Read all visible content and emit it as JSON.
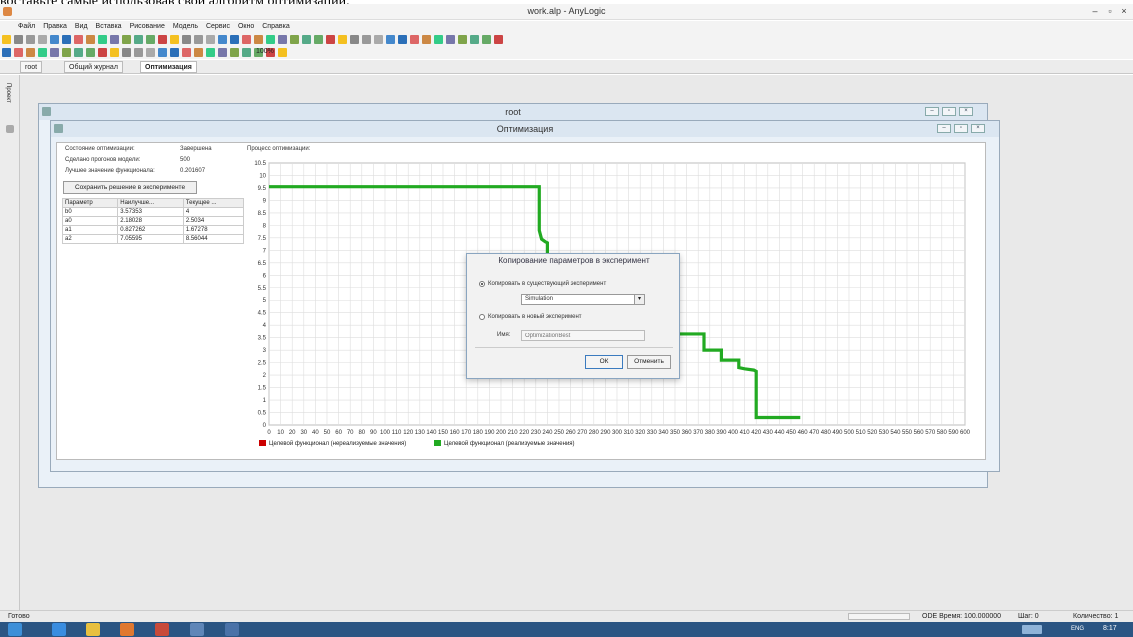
{
  "stripe_text": "воставьте самые использовав свой алгоритм оптимизации.",
  "window": {
    "title": "work.alp - AnyLogic",
    "min": "–",
    "max": "▫",
    "close": "×"
  },
  "menu": [
    "Файл",
    "Правка",
    "Вид",
    "Вставка",
    "Рисование",
    "Модель",
    "Сервис",
    "Окно",
    "Справка"
  ],
  "toolbar": {
    "zoom": "100%"
  },
  "tabs": [
    "root",
    "Общий журнал",
    "Оптимизация"
  ],
  "side_tab": "Проект",
  "mdi_root": {
    "title": "root"
  },
  "mdi_opt": {
    "title": "Оптимизация"
  },
  "opt": {
    "state_label": "Состояние оптимизации:",
    "state_value": "Завершена",
    "runs_label": "Сделано прогонов модели:",
    "runs_value": "500",
    "best_label": "Лучшее значение функционала:",
    "best_value": "0.201607",
    "save_button": "Сохранить решение в эксперименте",
    "progress_label": "Процесс оптимизации:",
    "table": {
      "headers": [
        "Параметр",
        "Наилучше...",
        "Текущее ..."
      ],
      "rows": [
        [
          "b0",
          "3.57353",
          "4"
        ],
        [
          "a0",
          "2.18028",
          "2.5034"
        ],
        [
          "a1",
          "0.827262",
          "1.67278"
        ],
        [
          "a2",
          "7.05595",
          "8.56044"
        ]
      ]
    }
  },
  "chart_data": {
    "type": "line",
    "xlim": [
      0,
      600
    ],
    "ylim": [
      0,
      10.5
    ],
    "grid": true,
    "legend_position": "bottom-left",
    "x_ticks": [
      0,
      10,
      20,
      30,
      40,
      50,
      60,
      70,
      80,
      90,
      100,
      110,
      120,
      130,
      140,
      150,
      160,
      170,
      180,
      190,
      200,
      210,
      220,
      230,
      240,
      250,
      260,
      270,
      280,
      290,
      300,
      310,
      320,
      330,
      340,
      350,
      360,
      370,
      380,
      390,
      400,
      410,
      420,
      430,
      440,
      450,
      460,
      470,
      480,
      490,
      500,
      510,
      520,
      530,
      540,
      550,
      560,
      570,
      580,
      590,
      600
    ],
    "y_ticks": [
      0,
      0.5,
      1,
      1.5,
      2,
      2.5,
      3,
      3.5,
      4,
      4.5,
      5,
      5.5,
      6,
      6.5,
      7,
      7.5,
      8,
      8.5,
      9,
      9.5,
      10,
      10.5
    ],
    "series": [
      {
        "name": "Целевой функционал (нереализуемые значения)",
        "color": "#cc0000",
        "points": []
      },
      {
        "name": "Целевой функционал (реализуемые значения)",
        "color": "#22aa22",
        "points": [
          [
            0,
            9.55
          ],
          [
            233,
            9.55
          ],
          [
            233,
            7.8
          ],
          [
            235,
            7.45
          ],
          [
            238,
            7.35
          ],
          [
            240,
            7.3
          ],
          [
            240,
            4.1
          ],
          [
            350,
            4.1
          ],
          [
            350,
            3.65
          ],
          [
            375,
            3.65
          ],
          [
            375,
            3.0
          ],
          [
            390,
            3.0
          ],
          [
            390,
            2.6
          ],
          [
            405,
            2.6
          ],
          [
            405,
            2.3
          ],
          [
            410,
            2.25
          ],
          [
            418,
            2.2
          ],
          [
            420,
            2.15
          ],
          [
            420,
            0.3
          ],
          [
            458,
            0.3
          ]
        ]
      }
    ]
  },
  "dialog": {
    "title": "Копирование параметров в эксперимент",
    "opt1": "Копировать в существующий эксперимент",
    "select_value": "Simulation",
    "opt2": "Копировать в новый эксперимент",
    "name_label": "Имя:",
    "name_placeholder": "OptimizationBest",
    "ok": "ОК",
    "cancel": "Отменить"
  },
  "status": {
    "left": "Готово",
    "ode": "ODE Время: 100.000000",
    "step": "Шаг: 0",
    "count": "Количество: 1"
  },
  "taskbar": {
    "lang": "ENG",
    "time": "8:17"
  }
}
